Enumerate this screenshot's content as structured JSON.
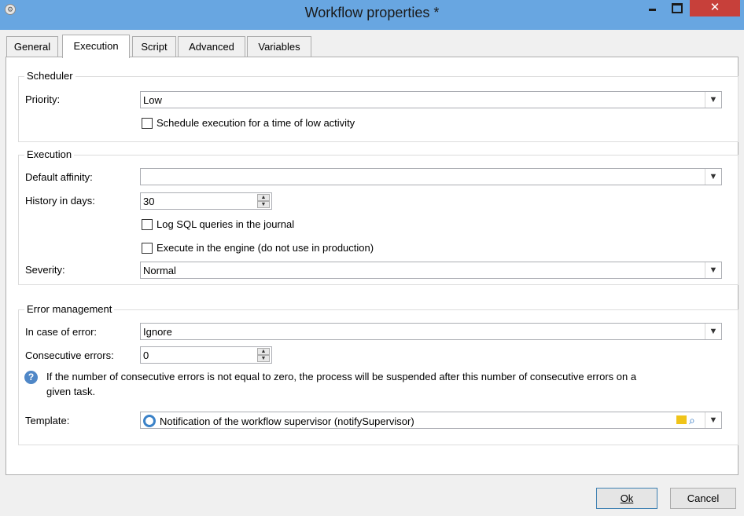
{
  "window": {
    "title": "Workflow properties *",
    "app_icon": "app-gear-icon",
    "close_glyph": "✕"
  },
  "tabs": [
    {
      "label": "General",
      "active": false
    },
    {
      "label": "Execution",
      "active": true
    },
    {
      "label": "Script",
      "active": false
    },
    {
      "label": "Advanced",
      "active": false
    },
    {
      "label": "Variables",
      "active": false
    }
  ],
  "scheduler": {
    "title": "Scheduler",
    "priority_label": "Priority:",
    "priority_value": "Low",
    "low_activity_label": "Schedule execution for a time of low activity",
    "low_activity_checked": false
  },
  "execution": {
    "title": "Execution",
    "affinity_label": "Default affinity:",
    "affinity_value": "",
    "history_label": "History in days:",
    "history_value": "30",
    "log_sql_label": "Log SQL queries in the journal",
    "log_sql_checked": false,
    "engine_label": "Execute in the engine (do not use in production)",
    "engine_checked": false,
    "severity_label": "Severity:",
    "severity_value": "Normal"
  },
  "errors": {
    "title": "Error management",
    "on_error_label": "In case of error:",
    "on_error_value": "Ignore",
    "consecutive_label": "Consecutive errors:",
    "consecutive_value": "0",
    "info_text_line1": "If the number of consecutive errors is not equal to zero, the process will be suspended after this number of consecutive errors on a",
    "info_text_line2": "given task.",
    "template_label": "Template:",
    "template_value": "Notification of the workflow supervisor (notifySupervisor)"
  },
  "buttons": {
    "ok": "Ok",
    "cancel": "Cancel"
  },
  "colors": {
    "titlebar": "#68a6e1",
    "close_button": "#c7403a",
    "accent": "#3b82c8"
  }
}
